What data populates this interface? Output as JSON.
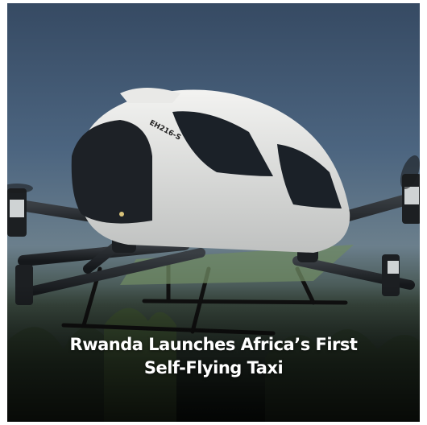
{
  "post": {
    "headline_line1": "Rwanda Launches Africa’s First",
    "headline_line2": "Self-Flying Taxi"
  },
  "image": {
    "subject": "passenger drone",
    "tail_marking": "EH216-S"
  }
}
